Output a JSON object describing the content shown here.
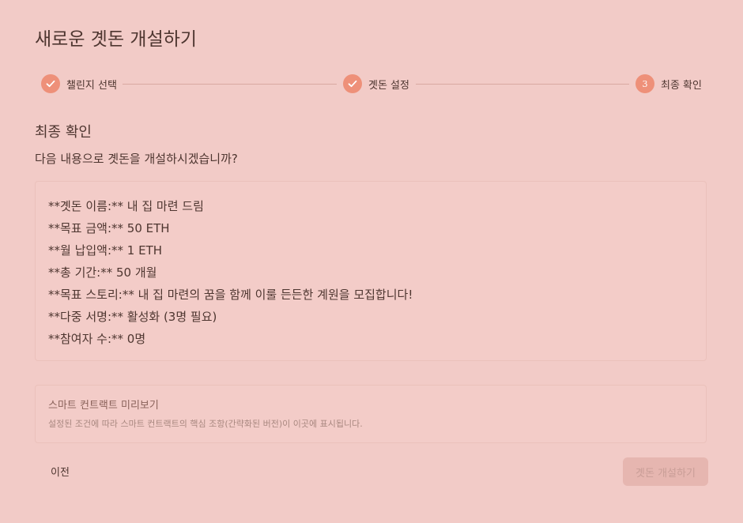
{
  "page": {
    "title": "새로운 곗돈 개설하기"
  },
  "stepper": {
    "steps": [
      {
        "label": "챌린지 선택",
        "status": "completed",
        "icon": "check-icon"
      },
      {
        "label": "곗돈 설정",
        "status": "completed",
        "icon": "check-icon"
      },
      {
        "label": "최종 확인",
        "status": "active",
        "number": "3"
      }
    ]
  },
  "confirm": {
    "title": "최종 확인",
    "subtitle": "다음 내용으로 곗돈을 개설하시겠습니까?",
    "lines": [
      "**곗돈 이름:** 내 집 마련 드림",
      "**목표 금액:** 50 ETH",
      "**월 납입액:** 1 ETH",
      "**총 기간:** 50 개월",
      "**목표 스토리:** 내 집 마련의 꿈을 함께 이룰 든든한 계원을 모집합니다!",
      "**다중 서명:** 활성화 (3명 필요)",
      "**참여자 수:** 0명"
    ]
  },
  "preview": {
    "title": "스마트 컨트랙트 미리보기",
    "description": "설정된 조건에 따라 스마트 컨트랙트의 핵심 조항(간략화된 버전)이 이곳에 표시됩니다."
  },
  "actions": {
    "prev_label": "이전",
    "submit_label": "곗돈 개설하기"
  },
  "colors": {
    "background": "#f2cbc7",
    "accent": "#ee9079",
    "text": "#4e3630",
    "disabled_button": "#e6b6b0"
  }
}
